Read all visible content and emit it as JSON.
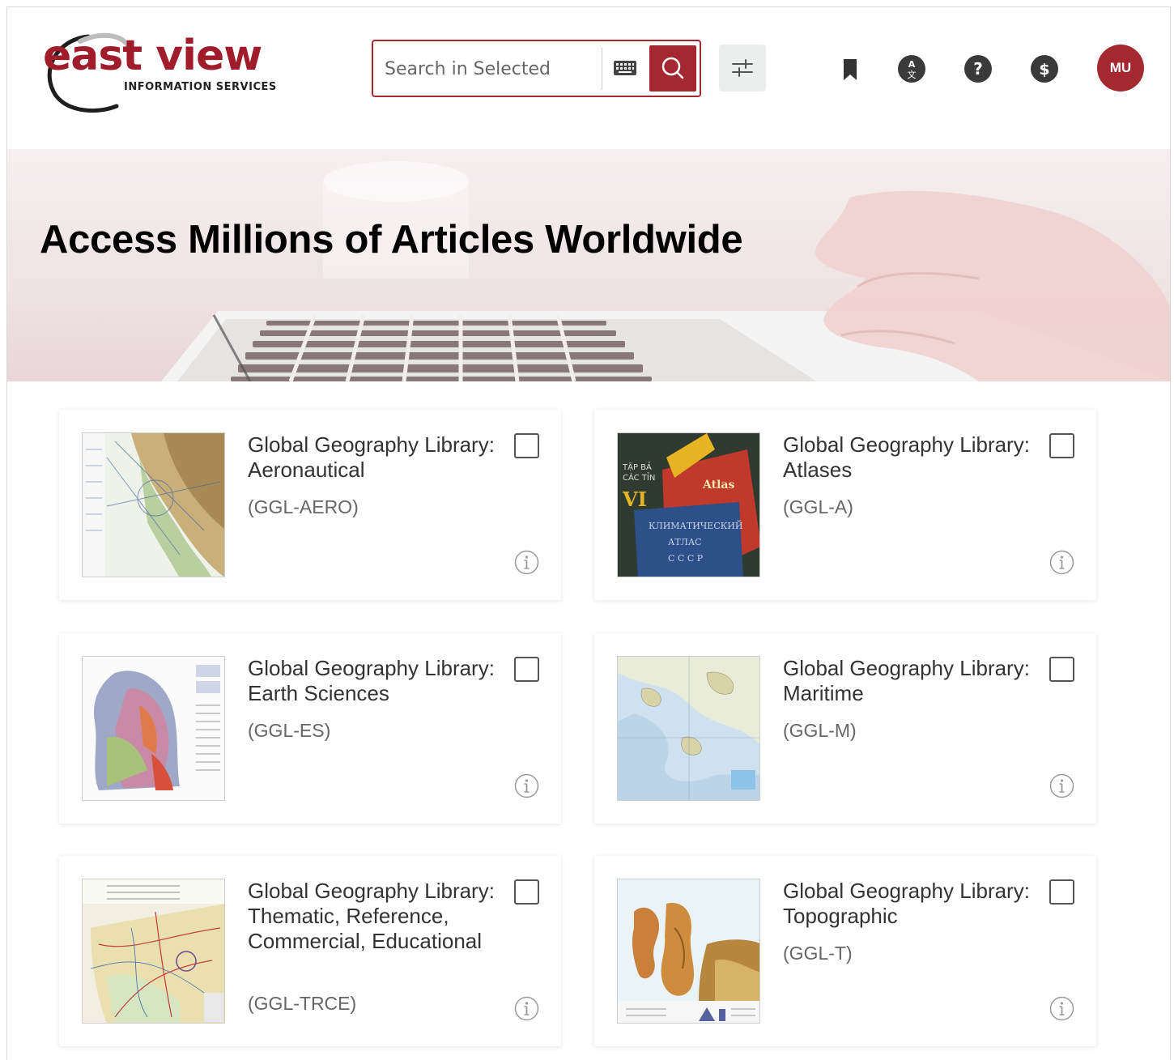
{
  "header": {
    "logo_main": "east view",
    "logo_sub": "INFORMATION SERVICES",
    "search_placeholder": "Search in Selected",
    "avatar_initials": "MU"
  },
  "hero": {
    "title": "Access Millions of Articles Worldwide"
  },
  "colors": {
    "brand": "#a5272f",
    "text": "#333333",
    "muted": "#666666",
    "icon_dark": "#333333"
  },
  "cards": [
    {
      "title": "Global Geography Library: Aeronautical",
      "code": "(GGL-AERO)",
      "thumb": "aeronautical-chart-thumbnail"
    },
    {
      "title": "Global Geography Library: Atlases",
      "code": "(GGL-A)",
      "thumb": "atlas-books-thumbnail"
    },
    {
      "title": "Global Geography Library: Earth Sciences",
      "code": "(GGL-ES)",
      "thumb": "geology-map-thumbnail"
    },
    {
      "title": "Global Geography Library: Maritime",
      "code": "(GGL-M)",
      "thumb": "nautical-chart-thumbnail"
    },
    {
      "title": "Global Geography Library: Thematic, Reference, Commercial, Educational",
      "code": "(GGL-TRCE)",
      "thumb": "road-map-thumbnail"
    },
    {
      "title": "Global Geography Library: Topographic",
      "code": "(GGL-T)",
      "thumb": "topographic-map-thumbnail"
    }
  ]
}
